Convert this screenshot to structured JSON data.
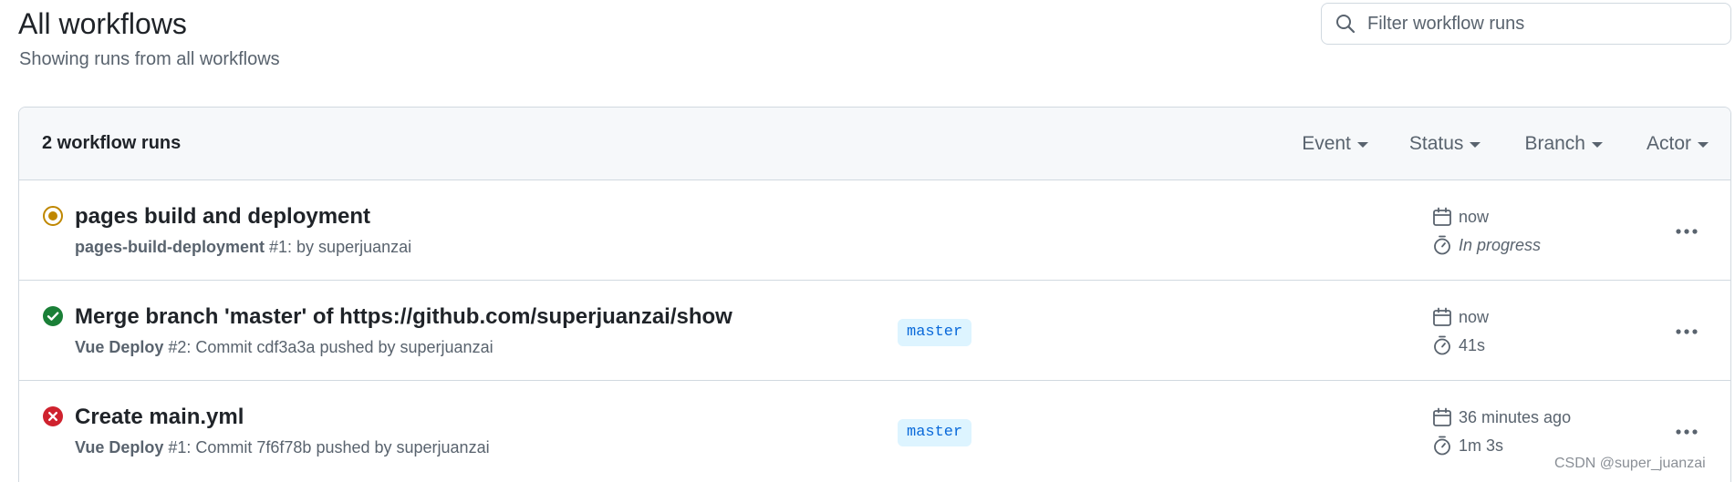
{
  "header": {
    "title": "All workflows",
    "subtitle": "Showing runs from all workflows"
  },
  "filter": {
    "placeholder": "Filter workflow runs",
    "icon": "search-icon"
  },
  "runs_header": {
    "count_label": "2 workflow runs",
    "filters": [
      "Event",
      "Status",
      "Branch",
      "Actor"
    ]
  },
  "runs": [
    {
      "status": "in_progress",
      "status_icon": "in-progress-icon",
      "status_color": "#bf8700",
      "title": "pages build and deployment",
      "workflow": "pages-build-deployment",
      "meta": " #1: by superjuanzai",
      "branch": "",
      "date": "now",
      "duration": "In progress"
    },
    {
      "status": "success",
      "status_icon": "check-circle-icon",
      "status_color": "#1a7f37",
      "title": "Merge branch 'master' of https://github.com/superjuanzai/show",
      "workflow": "Vue Deploy",
      "meta": " #2: Commit cdf3a3a pushed by superjuanzai",
      "branch": "master",
      "date": "now",
      "duration": "41s"
    },
    {
      "status": "failure",
      "status_icon": "x-circle-icon",
      "status_color": "#cf222e",
      "title": "Create main.yml",
      "workflow": "Vue Deploy",
      "meta": " #1: Commit 7f6f78b pushed by superjuanzai",
      "branch": "master",
      "date": "36 minutes ago",
      "duration": "1m 3s"
    }
  ],
  "watermark": "CSDN @super_juanzai"
}
